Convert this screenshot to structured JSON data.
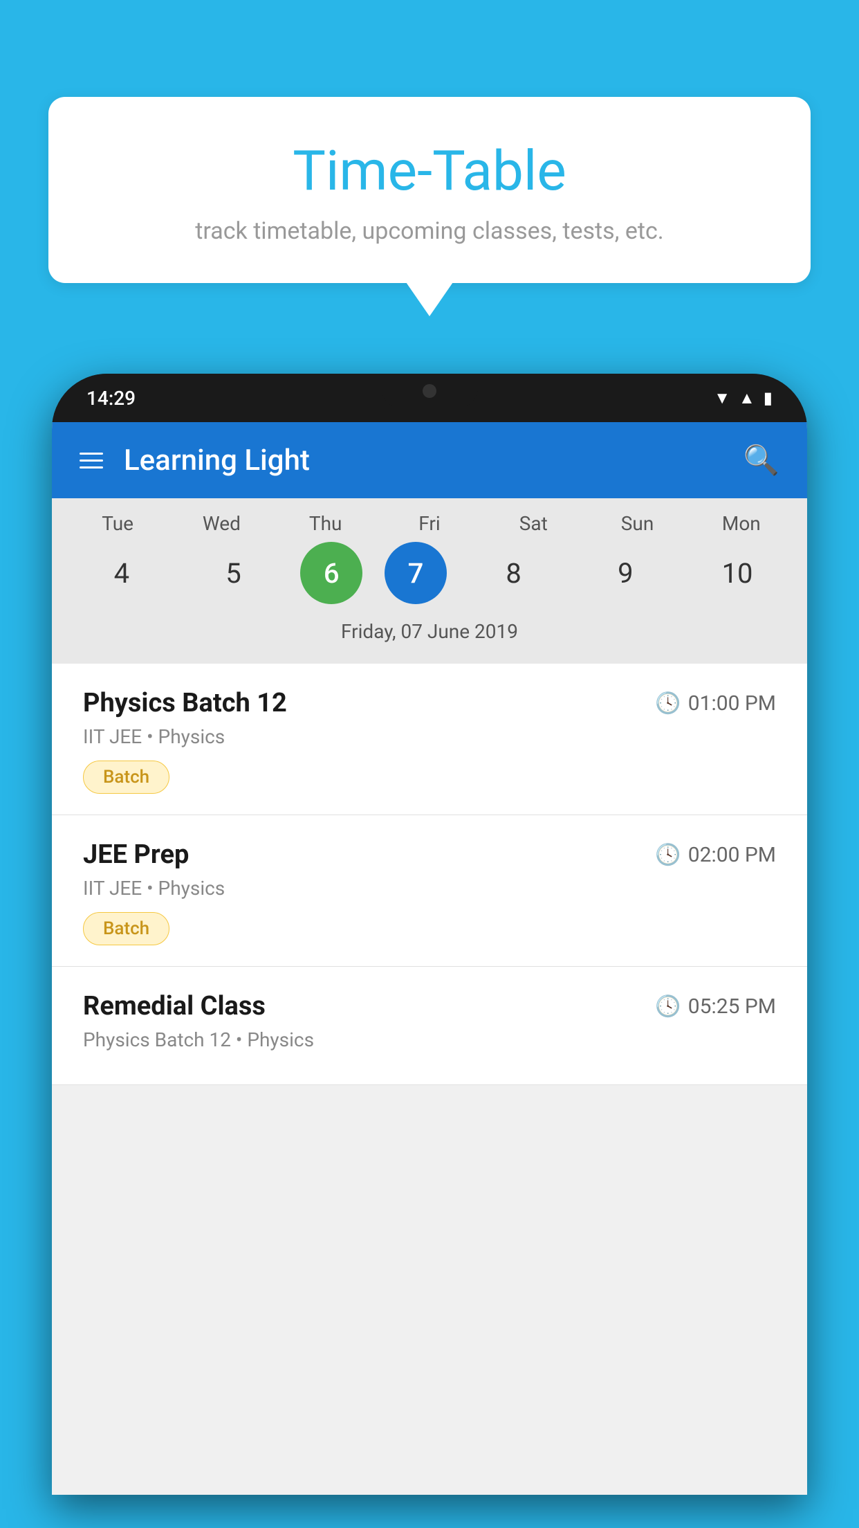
{
  "background_color": "#29B6E8",
  "bubble": {
    "title": "Time-Table",
    "subtitle": "track timetable, upcoming classes, tests, etc."
  },
  "status_bar": {
    "time": "14:29",
    "icons": [
      "wifi",
      "signal",
      "battery"
    ]
  },
  "app_header": {
    "title": "Learning Light",
    "menu_label": "Menu",
    "search_label": "Search"
  },
  "calendar": {
    "days": [
      {
        "label": "Tue",
        "number": "4"
      },
      {
        "label": "Wed",
        "number": "5"
      },
      {
        "label": "Thu",
        "number": "6",
        "state": "today"
      },
      {
        "label": "Fri",
        "number": "7",
        "state": "selected"
      },
      {
        "label": "Sat",
        "number": "8"
      },
      {
        "label": "Sun",
        "number": "9"
      },
      {
        "label": "Mon",
        "number": "10"
      }
    ],
    "selected_date_label": "Friday, 07 June 2019"
  },
  "classes": [
    {
      "name": "Physics Batch 12",
      "time": "01:00 PM",
      "meta": "IIT JEE • Physics",
      "badge": "Batch"
    },
    {
      "name": "JEE Prep",
      "time": "02:00 PM",
      "meta": "IIT JEE • Physics",
      "badge": "Batch"
    },
    {
      "name": "Remedial Class",
      "time": "05:25 PM",
      "meta": "Physics Batch 12 • Physics",
      "badge": null
    }
  ]
}
